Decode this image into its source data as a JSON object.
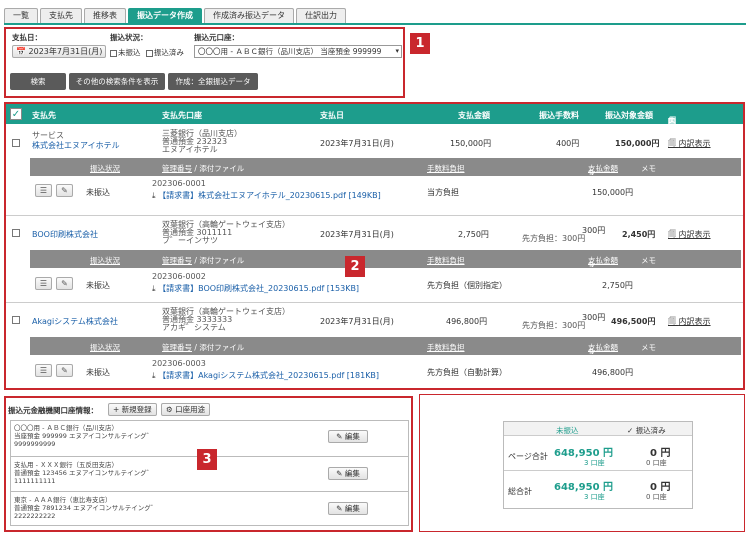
{
  "tabs": [
    "一覧",
    "支払先",
    "推移表",
    "振込データ作成",
    "作成済み振込データ",
    "仕訳出力"
  ],
  "active_tab": 3,
  "search": {
    "date_label": "支払日：",
    "date_value": "2023年7月31日(月)",
    "status_label": "振込状況：",
    "status_opt1": "未振込",
    "status_opt2": "振込済み",
    "source_label": "振込元口座：",
    "source_value": "〇〇〇用 - ＡＢＣ銀行（品川支店） 当座預金 999999",
    "search_btn": "検索",
    "more_btn": "その他の検索条件を表示",
    "create_btn": "作成：全銀振込データ"
  },
  "badges": [
    "1",
    "2",
    "3"
  ],
  "table": {
    "headers": {
      "payee": "支払先",
      "account": "支払先口座",
      "date": "支払日",
      "amount": "支払金額",
      "fee": "振込手数料",
      "target": "振込対象金額",
      "detail": "内訳表示"
    },
    "sub_headers": {
      "status": "振込状況",
      "mgmt": "管理番号",
      "sep": "/",
      "attach": "添付ファイル",
      "fee_burden": "手数料負担",
      "pay_amount": "支払金額",
      "memo": "メモ"
    },
    "rows": [
      {
        "prefix": "サービス",
        "name": "株式会社エヌアイホテル",
        "acct1": "三菱銀行（品川支店）",
        "acct2": "普通預金 232323",
        "acct3": "エヌアイホテル",
        "date": "2023年7月31日(月)",
        "amount": "150,000円",
        "fee1": "400円",
        "fee2": "",
        "target": "150,000円",
        "detail": "内訳表示",
        "status": "未振込",
        "mgmt": "202306-0001",
        "file": "【請求書】株式会社エヌアイホテル_20230615.pdf [149KB]",
        "burden": "当方負担",
        "pay": "150,000円"
      },
      {
        "prefix": "",
        "name": "BOO印刷株式会社",
        "acct1": "双葉銀行（高輪ゲートウェイ支店）",
        "acct2": "普通預金 3011111",
        "acct3": "ブ゛ーインサツ",
        "date": "2023年7月31日(月)",
        "amount": "2,750円",
        "fee1": "300円",
        "fee2": "先方負担：300円",
        "target": "2,450円",
        "detail": "内訳表示",
        "status": "未振込",
        "mgmt": "202306-0002",
        "file": "【請求書】BOO印刷株式会社_20230615.pdf [153KB]",
        "burden": "先方負担（個別指定）",
        "pay": "2,750円"
      },
      {
        "prefix": "",
        "name": "Akagiシステム株式会社",
        "acct1": "双葉銀行（高輪ゲートウェイ支店）",
        "acct2": "普通預金 3333333",
        "acct3": "アカギ゛システム",
        "date": "2023年7月31日(月)",
        "amount": "496,800円",
        "fee1": "300円",
        "fee2": "先方負担：300円",
        "target": "496,500円",
        "detail": "内訳表示",
        "status": "未振込",
        "mgmt": "202306-0003",
        "file": "【請求書】Akagiシステム株式会社_20230615.pdf [181KB]",
        "burden": "先方負担（自動計算）",
        "pay": "496,800円"
      }
    ]
  },
  "bank": {
    "title": "振込元金融機関口座情報：",
    "new_btn": "新規登録",
    "use_btn": "口座用途",
    "edit_label": "編集",
    "accounts": [
      {
        "l1": "〇〇〇用 - ＡＢＣ銀行（品川支店）",
        "l2": "当座預金 999999 エヌアイコンサルテイング゛",
        "l3": "9999999999"
      },
      {
        "l1": "支払用 - ＸＸＸ銀行（五反田支店）",
        "l2": "普通預金 123456 エヌアイコンサルテイング゛",
        "l3": "1111111111"
      },
      {
        "l1": "東京 - ＡＡＡ銀行（恵比寿支店）",
        "l2": "普通預金 7891234 エヌアイコンサルテイング゛",
        "l3": "2222222222"
      }
    ]
  },
  "summary": {
    "col1": "未振込",
    "col2": "振込済み",
    "page_label": "ページ合計",
    "total_label": "総合計",
    "page_unpaid": "648,950 円",
    "page_unpaid_cnt": "3 口座",
    "page_paid": "0 円",
    "page_paid_cnt": "0 口座",
    "total_unpaid": "648,950 円",
    "total_unpaid_cnt": "3 口座",
    "total_paid": "0 円",
    "total_paid_cnt": "0 口座"
  }
}
